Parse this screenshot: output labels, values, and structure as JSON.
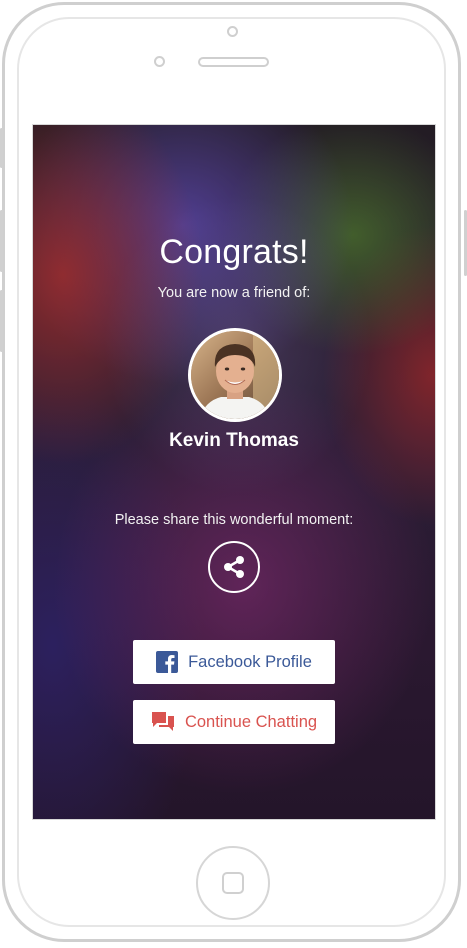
{
  "congrats": {
    "title": "Congrats!",
    "subtitle": "You are now a friend of:"
  },
  "friend": {
    "name": "Kevin Thomas"
  },
  "share": {
    "prompt": "Please share this wonderful moment:",
    "icon": "share-icon"
  },
  "actions": {
    "facebook_label": "Facebook Profile",
    "facebook_icon": "facebook-icon",
    "facebook_color": "#3b5998",
    "chat_label": "Continue Chatting",
    "chat_icon": "chat-bubbles-icon",
    "chat_color": "#d9534f"
  }
}
